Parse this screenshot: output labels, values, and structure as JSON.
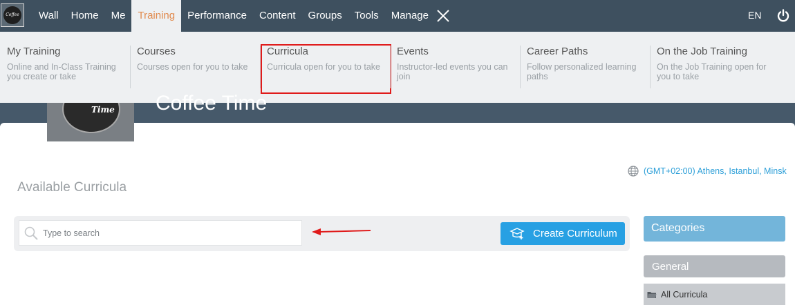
{
  "logo": {
    "text": "Coffee"
  },
  "nav": {
    "items": [
      {
        "id": "wall",
        "label": "Wall"
      },
      {
        "id": "home",
        "label": "Home"
      },
      {
        "id": "me",
        "label": "Me"
      },
      {
        "id": "training",
        "label": "Training",
        "active": true
      },
      {
        "id": "performance",
        "label": "Performance"
      },
      {
        "id": "content",
        "label": "Content"
      },
      {
        "id": "groups",
        "label": "Groups"
      },
      {
        "id": "tools",
        "label": "Tools"
      },
      {
        "id": "manage",
        "label": "Manage"
      }
    ],
    "close_icon": "close-icon",
    "language": "EN",
    "power_icon": "power-icon"
  },
  "dropdown": {
    "items": [
      {
        "title": "My Training",
        "subtitle": "Online and In-Class Training you create or take"
      },
      {
        "title": "Courses",
        "subtitle": "Courses open for you to take"
      },
      {
        "title": "Curricula",
        "subtitle": "Curricula open for you to take",
        "highlighted": true
      },
      {
        "title": "Events",
        "subtitle": "Instructor-led events you can join"
      },
      {
        "title": "Career Paths",
        "subtitle": "Follow personalized learning paths"
      },
      {
        "title": "On the Job Training",
        "subtitle": "On the Job Training open for you to take"
      }
    ]
  },
  "cover": {
    "logo_text": "Time",
    "title": "Coffee Time"
  },
  "timezone": "(GMT+02:00) Athens, Istanbul, Minsk",
  "page_title": "Available Curricula",
  "search": {
    "placeholder": "Type to search",
    "value": ""
  },
  "create_button": {
    "label": "Create Curriculum"
  },
  "sidebar": {
    "categories_title": "Categories",
    "group_label": "General",
    "items": [
      {
        "label": "All Curricula"
      }
    ]
  },
  "colors": {
    "topbar": "#3e505f",
    "active_nav": "#e18a4d",
    "accent": "#27a0e3",
    "highlight_box": "#e01b1b"
  }
}
